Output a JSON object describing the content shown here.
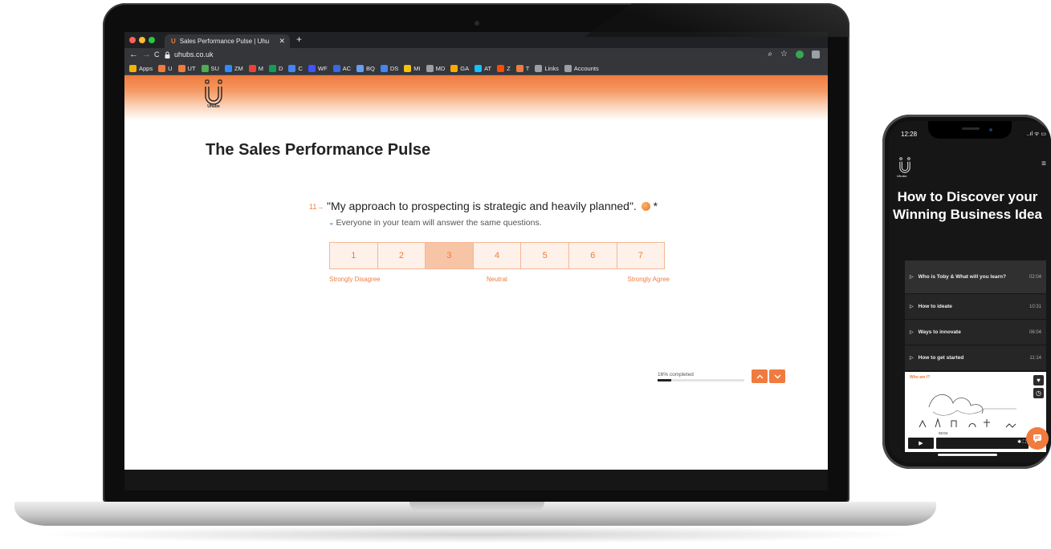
{
  "browser": {
    "tab_title": "Sales Performance Pulse | Uhu",
    "tab_close": "✕",
    "new_tab": "+",
    "nav_back": "←",
    "nav_forward": "→",
    "nav_reload": "C",
    "url": "uhubs.co.uk",
    "bookmarks": [
      {
        "label": "Apps",
        "color": "#f4b400"
      },
      {
        "label": "U",
        "color": "#f07b3f"
      },
      {
        "label": "UT",
        "color": "#f07b3f"
      },
      {
        "label": "SU",
        "color": "#4caf50"
      },
      {
        "label": "ZM",
        "color": "#2d8cff"
      },
      {
        "label": "M",
        "color": "#ea4335"
      },
      {
        "label": "D",
        "color": "#0f9d58"
      },
      {
        "label": "C",
        "color": "#4285f4"
      },
      {
        "label": "WF",
        "color": "#4353ff"
      },
      {
        "label": "AC",
        "color": "#356ae6"
      },
      {
        "label": "BQ",
        "color": "#669df6"
      },
      {
        "label": "DS",
        "color": "#4285f4"
      },
      {
        "label": "MI",
        "color": "#f4c20d"
      },
      {
        "label": "MD",
        "color": "#9e9e9e"
      },
      {
        "label": "GA",
        "color": "#f9ab00"
      },
      {
        "label": "AT",
        "color": "#18bfff"
      },
      {
        "label": "Z",
        "color": "#ff4a00"
      },
      {
        "label": "T",
        "color": "#f07b3f"
      },
      {
        "label": "Links",
        "color": "#9aa0a6"
      },
      {
        "label": "Accounts",
        "color": "#9aa0a6"
      }
    ]
  },
  "page": {
    "logo_text": "Uhubs",
    "title": "The Sales Performance Pulse",
    "question_number": "11→",
    "question_text": "\"My approach to prospecting is strategic and heavily planned\".",
    "required_mark": "*",
    "question_subtext": "Everyone in your team will answer the same questions.",
    "scale_options": [
      "1",
      "2",
      "3",
      "4",
      "5",
      "6",
      "7"
    ],
    "selected_value": 3,
    "scale_label_low": "Strongly Disagree",
    "scale_label_mid": "Neutral",
    "scale_label_high": "Strongly Agree",
    "progress_text": "16% completed",
    "progress_percent": 16,
    "nav_up": "^",
    "nav_down": "v"
  },
  "phone": {
    "time": "12:28",
    "status_icons": "..ıl ᯤ ▭",
    "logo_text": "Uhubs",
    "title": "How to Discover your Winning Business Idea",
    "lessons": [
      {
        "title": "Who is Toby & What will you learn?",
        "duration": "02:04"
      },
      {
        "title": "How to ideate",
        "duration": "10:31"
      },
      {
        "title": "Ways to innovate",
        "duration": "06:04"
      },
      {
        "title": "How to get started",
        "duration": "11:14"
      }
    ],
    "video_title": "Who am I?",
    "video_time": "02:04"
  },
  "colors": {
    "accent": "#f07b3f",
    "selected": "#f7c4a6",
    "chrome_dark": "#202124"
  }
}
